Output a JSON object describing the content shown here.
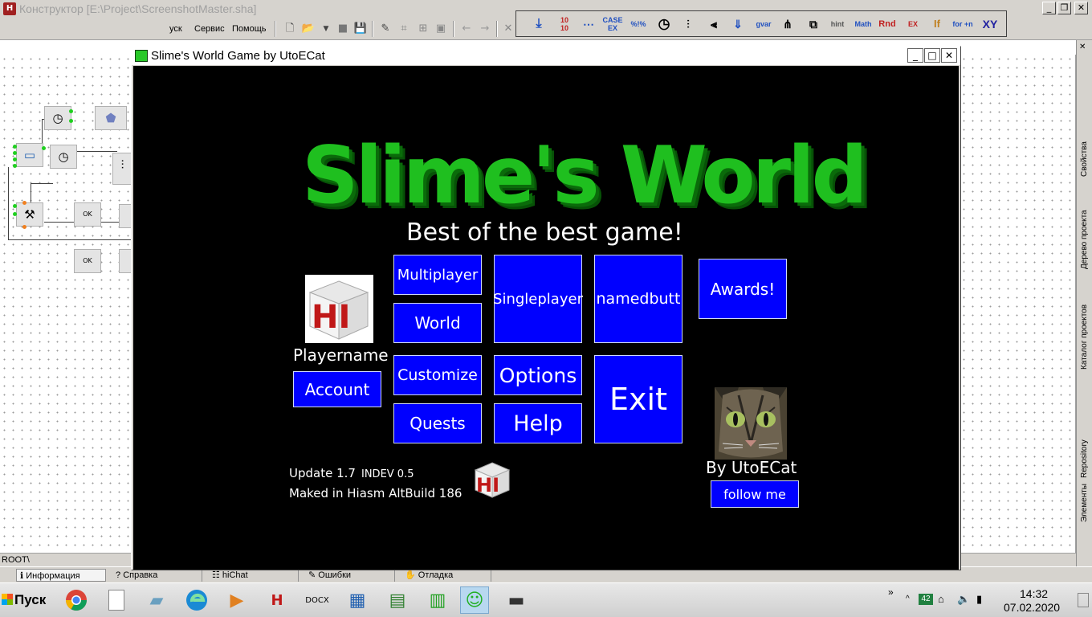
{
  "ide": {
    "title": "Конструктор [E:\\Project\\ScreenshotMaster.sha]",
    "menu": [
      "уск",
      "Сервис",
      "Помощь"
    ],
    "palette": [
      "CASE EX",
      "%!%",
      "gvar",
      "hint",
      "Math",
      "Rnd",
      "EX",
      "If",
      "for +n",
      "XY"
    ],
    "status_path": "ROOT\\",
    "bottom_tabs": [
      "Информация",
      "Справка",
      "hiChat",
      "Ошибки",
      "Отладка"
    ],
    "dock_tabs": [
      "Свойства",
      "Дерево проекта",
      "Каталог проектов",
      "Repository",
      "Элементы"
    ]
  },
  "game": {
    "window_title": "Slime's World Game by UtoECat",
    "logo": "Slime's World",
    "tagline": "Best of the best game!",
    "buttons": {
      "multiplayer": "Multiplayer",
      "world": "World",
      "singleplayer": "Singleplayer",
      "namedbutt": "namedbutt",
      "awards": "Awards!",
      "customize": "Customize",
      "options": "Options",
      "exit": "Exit",
      "quests": "Quests",
      "help": "Help",
      "account": "Account",
      "follow": "follow me"
    },
    "playername": "Playername",
    "author": "By UtoECat",
    "version": "Update 1.7",
    "indev": "INDEV 0.5",
    "built_with": "Maked in Hiasm AltBuild 186",
    "hi_text": "HI"
  },
  "taskbar": {
    "start": "Пуск",
    "battery": "42",
    "time": "14:32",
    "date": "07.02.2020"
  },
  "colors": {
    "game_bg": "#000000",
    "button_bg": "#0000ff",
    "logo_green": "#1fbf1f"
  }
}
